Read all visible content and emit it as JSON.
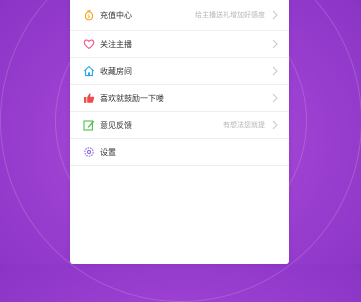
{
  "colors": {
    "background": "#9a3fd0",
    "panel": "#ffffff",
    "text": "#333333",
    "hint": "#b5b5b5",
    "chevron": "#c8c8c8"
  },
  "menu": {
    "items": [
      {
        "label": "充值中心",
        "hint": "给主播送礼增加好感度",
        "icon": "coin-bag-icon",
        "icon_color": "#f5a623"
      },
      {
        "label": "关注主播",
        "hint": "",
        "icon": "heart-icon",
        "icon_color": "#f2558a"
      },
      {
        "label": "收藏房间",
        "hint": "",
        "icon": "home-icon",
        "icon_color": "#2aa7e8"
      },
      {
        "label": "喜欢就鼓励一下喽",
        "hint": "",
        "icon": "thumbs-up-icon",
        "icon_color": "#f04a4a"
      },
      {
        "label": "意见反馈",
        "hint": "有想法您就提",
        "icon": "edit-icon",
        "icon_color": "#4fc04a"
      },
      {
        "label": "设置",
        "hint": "",
        "icon": "gear-icon",
        "icon_color": "#8a6ad8"
      }
    ]
  }
}
